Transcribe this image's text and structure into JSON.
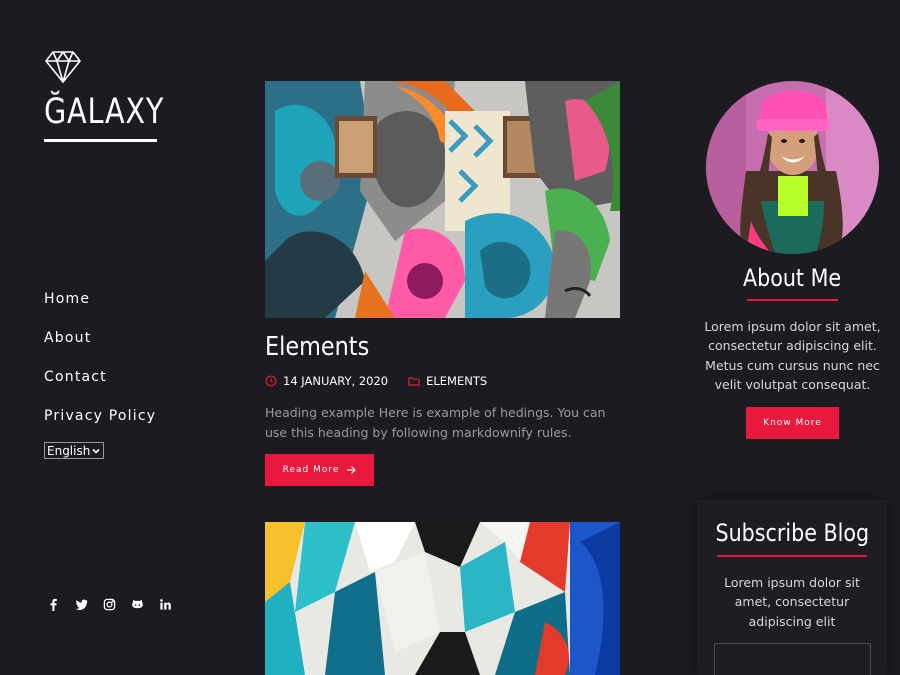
{
  "brand": {
    "name": "ĞALAXY",
    "icon": "diamond-icon"
  },
  "nav": {
    "items": [
      {
        "label": "Home"
      },
      {
        "label": "About"
      },
      {
        "label": "Contact"
      },
      {
        "label": "Privacy Policy"
      }
    ]
  },
  "language": {
    "selected": "English"
  },
  "socials": [
    "facebook-icon",
    "twitter-icon",
    "instagram-icon",
    "github-icon",
    "linkedin-icon"
  ],
  "posts": [
    {
      "title": "Elements",
      "date": "14 JANUARY, 2020",
      "category": "ELEMENTS",
      "excerpt": "Heading example Here is example of hedings. You can use this heading by following markdownify rules.",
      "read_more": "Read More"
    }
  ],
  "about": {
    "title": "About Me",
    "text": "Lorem ipsum dolor sit amet, consectetur adipiscing elit. Metus cum cursus nunc nec velit volutpat consequat.",
    "button": "Know More"
  },
  "subscribe": {
    "title": "Subscribe Blog",
    "text": "Lorem ipsum dolor sit amet, consectetur adipiscing elit"
  },
  "colors": {
    "background": "#1c1b21",
    "accent": "#e8193c",
    "muted_text": "#9b9aa3"
  }
}
